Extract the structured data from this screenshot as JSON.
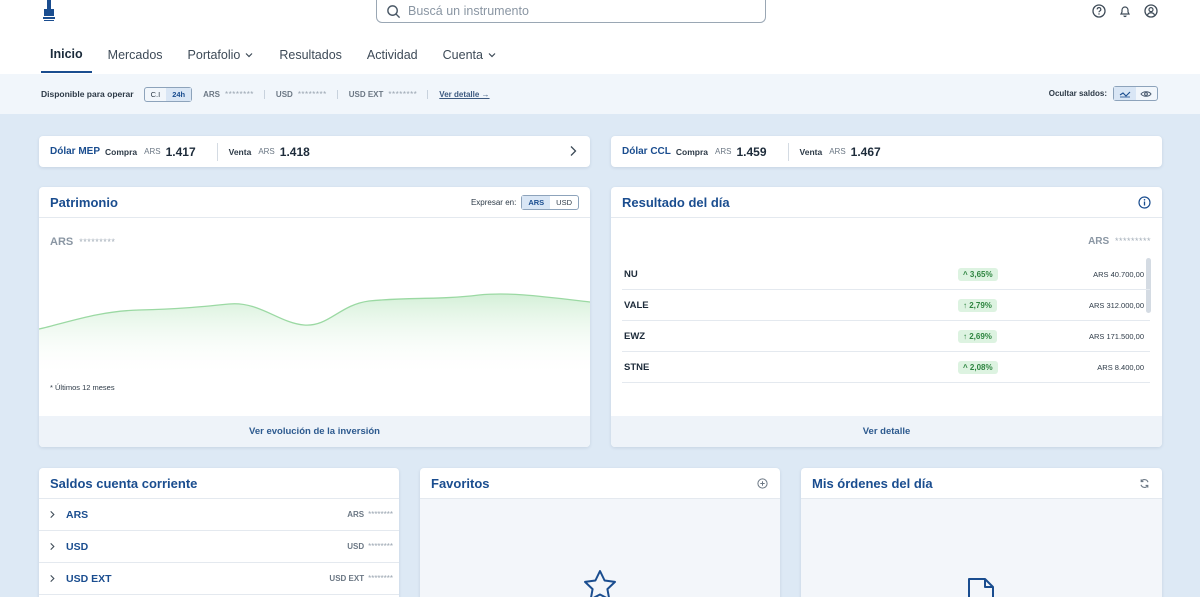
{
  "header": {
    "search_placeholder": "Buscá un instrumento",
    "nav": [
      {
        "label": "Inicio"
      },
      {
        "label": "Mercados"
      },
      {
        "label": "Portafolio"
      },
      {
        "label": "Resultados"
      },
      {
        "label": "Actividad"
      },
      {
        "label": "Cuenta"
      }
    ]
  },
  "available": {
    "label": "Disponible para operar",
    "term_options": [
      "C.I",
      "24h"
    ],
    "selected_term": "24h",
    "currencies": [
      {
        "code": "ARS",
        "value": "********"
      },
      {
        "code": "USD",
        "value": "********"
      },
      {
        "code": "USD EXT",
        "value": "********"
      }
    ],
    "detail_link": "Ver detalle →",
    "hide_label": "Ocultar saldos:"
  },
  "fx": {
    "mep": {
      "name": "Dólar MEP",
      "buy_label": "Compra",
      "buy_cur": "ARS",
      "buy_value": "1.417",
      "sell_label": "Venta",
      "sell_cur": "ARS",
      "sell_value": "1.418"
    },
    "ccl": {
      "name": "Dólar CCL",
      "buy_label": "Compra",
      "buy_cur": "ARS",
      "buy_value": "1.459",
      "sell_label": "Venta",
      "sell_cur": "ARS",
      "sell_value": "1.467"
    }
  },
  "patrimonio": {
    "title": "Patrimonio",
    "express_label": "Expresar en:",
    "express_options": [
      "ARS",
      "USD"
    ],
    "selected": "ARS",
    "currency": "ARS",
    "value": "*********",
    "note": "* Últimos 12 meses",
    "footer_link": "Ver evolución de la inversión"
  },
  "resultado": {
    "title": "Resultado del día",
    "currency": "ARS",
    "value": "*********",
    "rows": [
      {
        "ticker": "NU",
        "pct": "^ 3,65%",
        "amount": "ARS 40.700,00"
      },
      {
        "ticker": "VALE",
        "pct": "↑ 2,79%",
        "amount": "ARS 312.000,00"
      },
      {
        "ticker": "EWZ",
        "pct": "↑ 2,69%",
        "amount": "ARS 171.500,00"
      },
      {
        "ticker": "STNE",
        "pct": "^ 2,08%",
        "amount": "ARS 8.400,00"
      }
    ],
    "footer_link": "Ver detalle"
  },
  "saldos": {
    "title": "Saldos cuenta corriente",
    "rows": [
      {
        "label": "ARS",
        "code": "ARS",
        "value": "********"
      },
      {
        "label": "USD",
        "code": "USD",
        "value": "********"
      },
      {
        "label": "USD EXT",
        "code": "USD EXT",
        "value": "********"
      }
    ]
  },
  "favoritos": {
    "title": "Favoritos"
  },
  "ordenes": {
    "title": "Mis órdenes del día"
  },
  "colors": {
    "brand": "#1a4d8f",
    "positive": "#2e8540",
    "page_bg": "#dde9f5"
  }
}
